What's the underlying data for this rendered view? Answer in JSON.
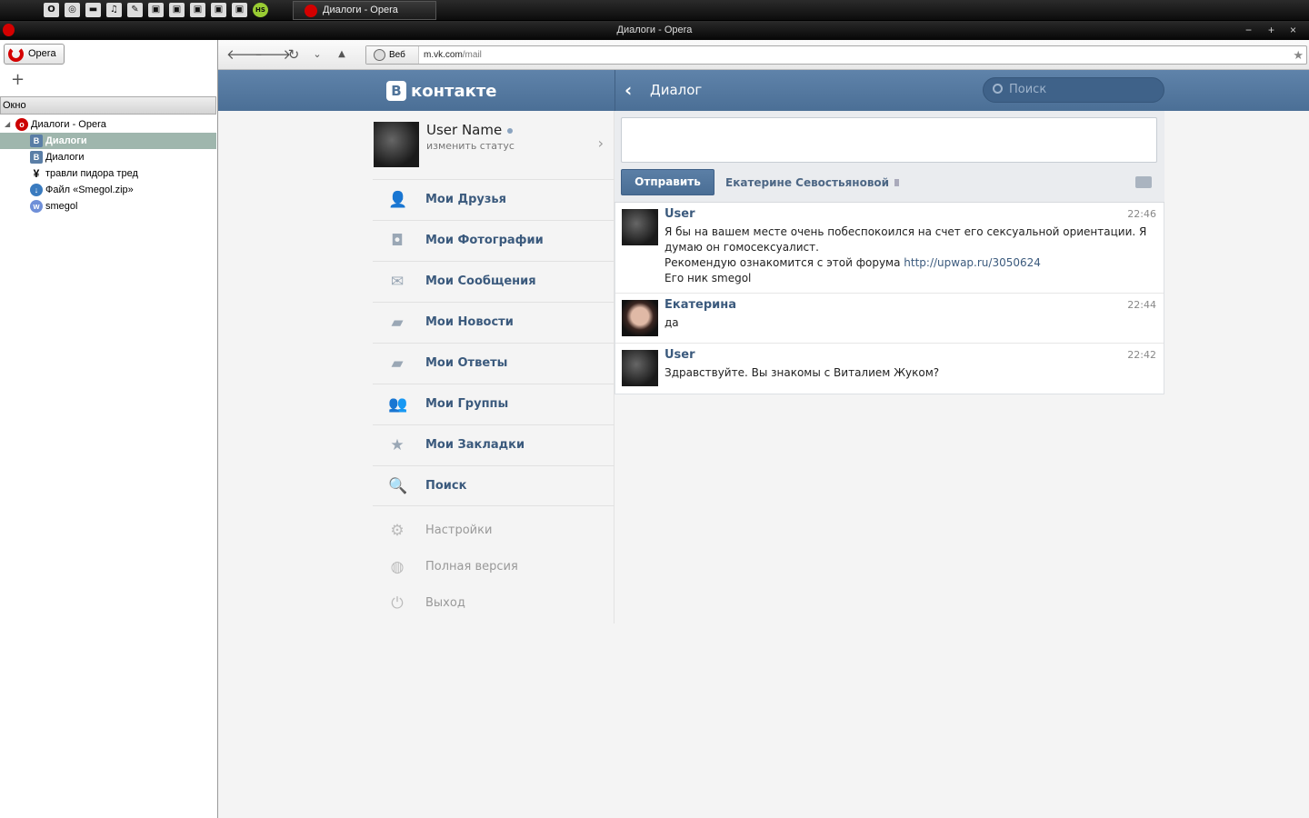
{
  "taskbar": {
    "icons": [
      "O",
      "◎",
      "▬",
      "♫",
      "✎",
      "▣",
      "▣",
      "▣",
      "▣",
      "▣",
      "HS"
    ],
    "active_task": "Диалоги - Opera"
  },
  "window": {
    "title": "Диалоги - Opera",
    "controls": {
      "minimize": "−",
      "maximize": "+",
      "close": "×"
    }
  },
  "sidebar": {
    "opera_button": "Opera",
    "add": "+",
    "panel_title": "Окно",
    "tree": [
      {
        "label": "Диалоги - Opera",
        "icon": "opera-icon",
        "root": true
      },
      {
        "label": "Диалоги",
        "icon": "vk-icon",
        "selected": true
      },
      {
        "label": "Диалоги",
        "icon": "vk-icon"
      },
      {
        "label": "травли пидора тред",
        "icon": "site-icon"
      },
      {
        "label": "Файл «Smegol.zip»",
        "icon": "download-icon"
      },
      {
        "label": "smegol",
        "icon": "globe-icon"
      }
    ]
  },
  "toolbar": {
    "back": "🡐",
    "forward": "🡒",
    "reload": "↻",
    "history": "⌄",
    "up": "▲",
    "address_badge": "Веб",
    "url_host": "m.vk.com",
    "url_path": "/mail",
    "bookmark": "★"
  },
  "vk": {
    "logo_letter": "В",
    "logo_text": "контакте",
    "back_arrow": "‹",
    "dialog_title": "Диалог",
    "search_placeholder": "Поиск",
    "profile": {
      "name": "User Name",
      "status": "изменить статус",
      "arrow": "›"
    },
    "menu": [
      {
        "label": "Мои Друзья",
        "icon": "👤"
      },
      {
        "label": "Мои Фотографии",
        "icon": "◘"
      },
      {
        "label": "Мои Сообщения",
        "icon": "✉"
      },
      {
        "label": "Мои Новости",
        "icon": "▰"
      },
      {
        "label": "Мои Ответы",
        "icon": "▰"
      },
      {
        "label": "Мои Группы",
        "icon": "👥"
      },
      {
        "label": "Мои Закладки",
        "icon": "★"
      },
      {
        "label": "Поиск",
        "icon": "🔍"
      }
    ],
    "menu_secondary": [
      {
        "label": "Настройки",
        "icon": "⚙"
      },
      {
        "label": "Полная версия",
        "icon": "◍"
      },
      {
        "label": "Выход",
        "icon": "⏻"
      }
    ],
    "compose": {
      "send_label": "Отправить",
      "recipient": "Екатерине Севостьяновой"
    },
    "messages": [
      {
        "author": "User",
        "time": "22:46",
        "lines": [
          "Я бы на вашем месте очень побеспокоился на счет его сексуальной ориентации. Я думаю он гомосексуалист.",
          "Рекомендую ознакомится с этой форума ",
          "Его ник smegol"
        ],
        "link": "http://upwap.ru/3050624"
      },
      {
        "author": "Екатерина",
        "time": "22:44",
        "lines": [
          "да"
        ]
      },
      {
        "author": "User",
        "time": "22:42",
        "lines": [
          "Здравствуйте. Вы знакомы с Виталием Жуком?"
        ]
      }
    ]
  }
}
